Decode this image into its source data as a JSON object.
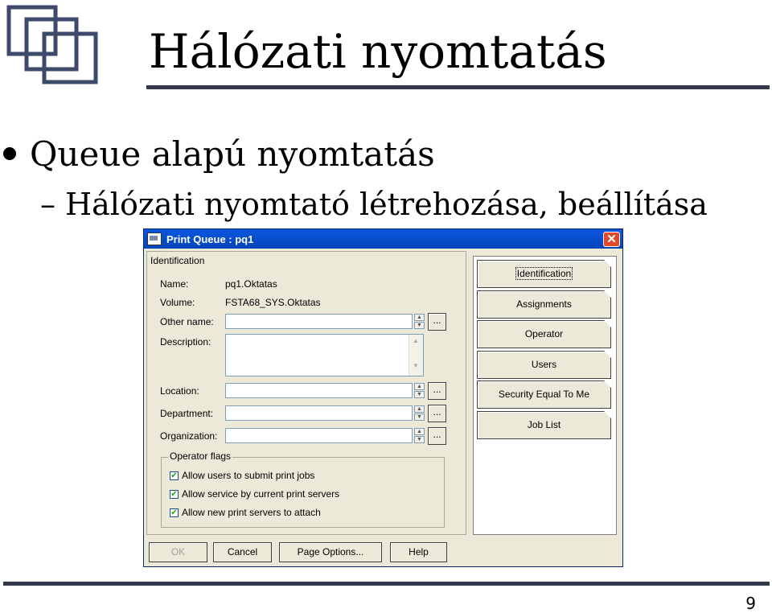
{
  "slide": {
    "title": "Hálózati nyomtatás",
    "bullet1": "Queue alapú nyomtatás",
    "bullet2": "Hálózati nyomtató létrehozása, beállítása",
    "page_number": "9"
  },
  "dialog": {
    "title": "Print Queue : pq1",
    "section_title": "Identification",
    "name_label": "Name:",
    "name_value": "pq1.Oktatas",
    "volume_label": "Volume:",
    "volume_value": "FSTA68_SYS.Oktatas",
    "other_name_label": "Other name:",
    "description_label": "Description:",
    "location_label": "Location:",
    "department_label": "Department:",
    "organization_label": "Organization:",
    "ellipsis": "...",
    "operator_flags": {
      "title": "Operator flags",
      "items": [
        {
          "label": "Allow users to submit print jobs",
          "checked": true
        },
        {
          "label": "Allow service by current print servers",
          "checked": true
        },
        {
          "label": "Allow new print servers to attach",
          "checked": true
        }
      ]
    },
    "pages": [
      "Identification",
      "Assignments",
      "Operator",
      "Users",
      "Security Equal To Me",
      "Job List"
    ],
    "buttons": {
      "ok": "OK",
      "cancel": "Cancel",
      "page_options": "Page Options...",
      "help": "Help"
    }
  }
}
